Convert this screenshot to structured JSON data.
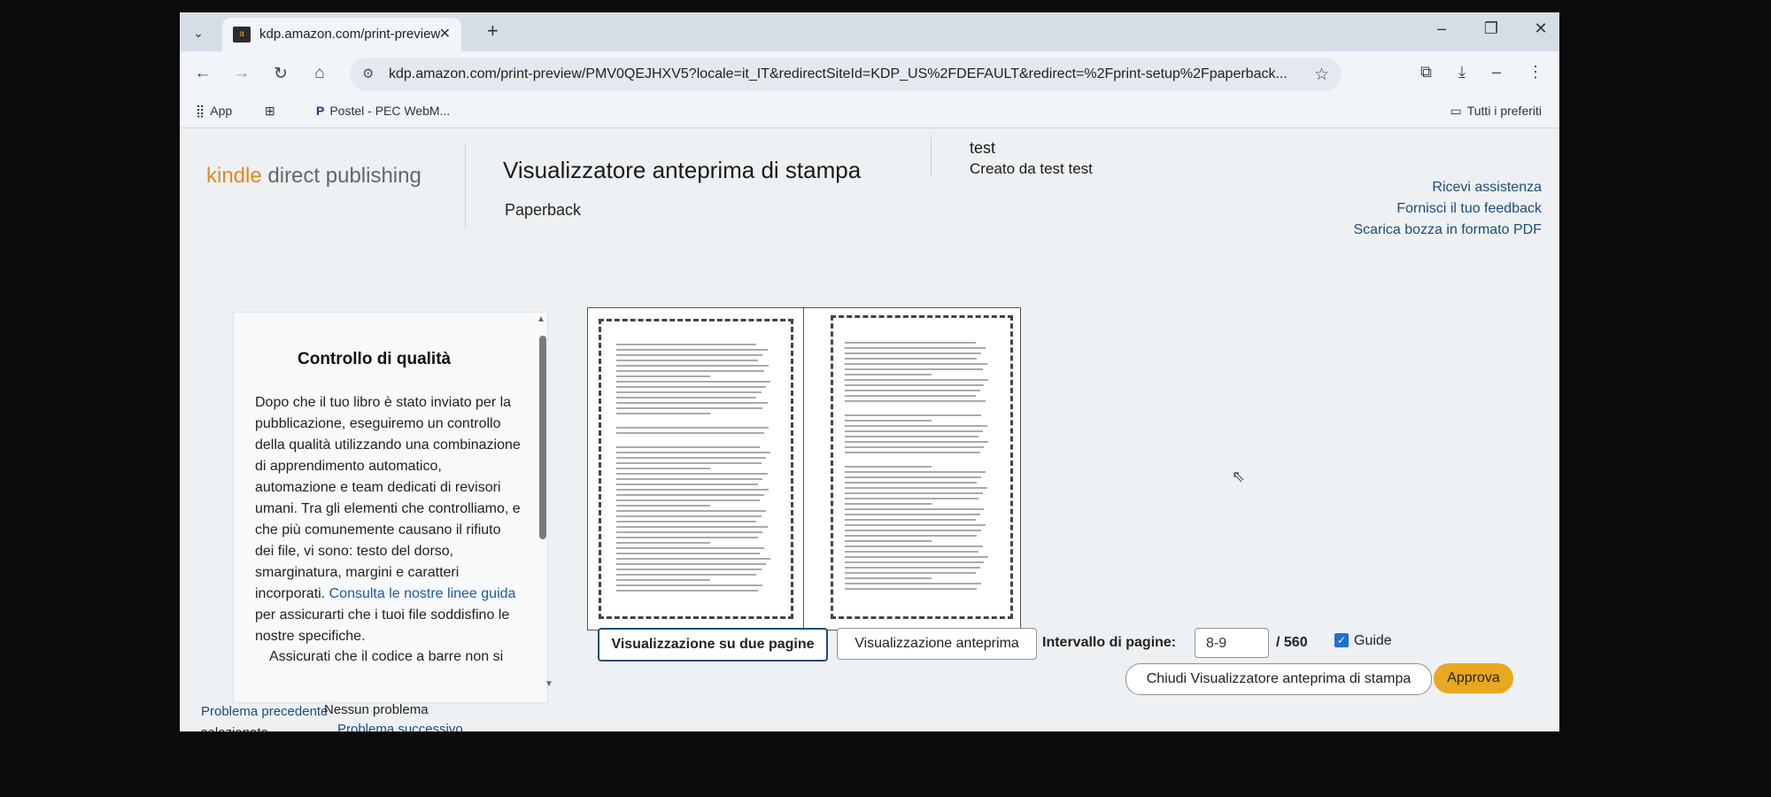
{
  "browser": {
    "tab_title": "kdp.amazon.com/print-preview",
    "new_tab_symbol": "+",
    "url": "kdp.amazon.com/print-preview/PMV0QEJHXV5?locale=it_IT&redirectSiteId=KDP_US%2FDEFAULT&redirect=%2Fprint-setup%2Fpaperback...",
    "bookmarks": {
      "apps": "App",
      "postel": "Postel - PEC WebM...",
      "all_bookmarks": "Tutti i preferiti"
    }
  },
  "header": {
    "logo_kindle": "kindle",
    "logo_rest": " direct publishing",
    "title": "Visualizzatore anteprima di stampa",
    "format": "Paperback",
    "book_title": "test",
    "book_author": "Creato da test test",
    "links": {
      "help": "Ricevi assistenza",
      "feedback": "Fornisci il tuo feedback",
      "download": "Scarica bozza in formato PDF"
    }
  },
  "qc": {
    "title": "Controllo di qualità",
    "body": "Dopo che il tuo libro è stato inviato per la pubblicazione, eseguiremo un controllo della qualità utilizzando una combinazione di apprendimento automatico, automazione e team dedicati di revisori umani. Tra gli elementi che controlliamo, e che più comunemente causano il rifiuto dei file, vi sono: testo del dorso, smarginatura, margini e caratteri incorporati.",
    "link": "Consulta le nostre linee guida",
    "body_end": "per assicurarti che i tuoi file soddisfino le nostre specifiche.",
    "body2": "Assicurati che il codice a barre non si",
    "prev_problem": "Problema precedente",
    "prev_selected": "selezionato",
    "no_problem": "Nessun problema",
    "next_problem": "Problema successivo"
  },
  "controls": {
    "two_pages": "Visualizzazione su due pagine",
    "preview": "Visualizzazione anteprima",
    "range_label": "Intervallo di pagine:",
    "range_value": "8-9",
    "range_total": "/ 560",
    "guides_label": "Guide",
    "guides_checked": true,
    "close": "Chiudi Visualizzatore anteprima di stampa",
    "approve": "Approva"
  },
  "colors": {
    "accent_link": "#1e4b7a",
    "approve_button": "#e8a820",
    "logo_orange": "#e08a1e"
  }
}
